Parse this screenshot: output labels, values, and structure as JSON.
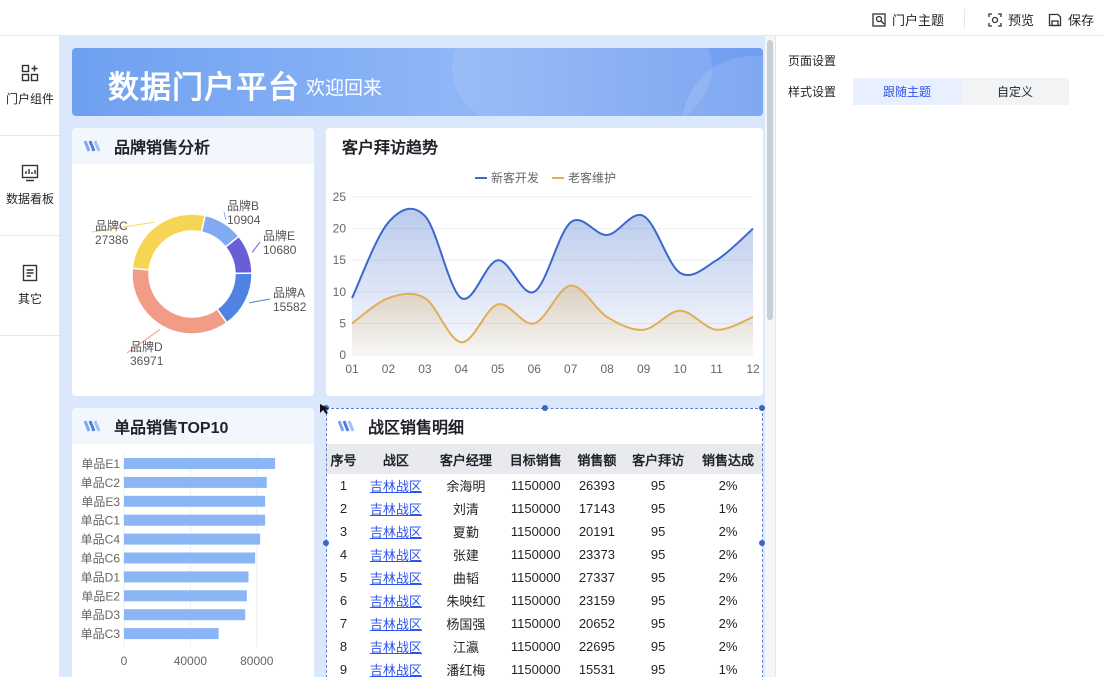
{
  "topbar": {
    "theme_label": "门户主题",
    "preview_label": "预览",
    "save_label": "保存"
  },
  "leftnav": {
    "items": [
      {
        "label": "门户组件",
        "icon": "components-icon"
      },
      {
        "label": "数据看板",
        "icon": "dashboard-icon"
      },
      {
        "label": "其它",
        "icon": "document-icon"
      }
    ]
  },
  "banner": {
    "title": "数据门户平台",
    "subtitle": "欢迎回来"
  },
  "cards": {
    "brand_title": "品牌销售分析",
    "visit_title": "客户拜访趋势",
    "top10_title": "单品销售TOP10",
    "region_title": "战区销售明细"
  },
  "right_panel": {
    "page_settings": "页面设置",
    "style_settings": "样式设置",
    "options": [
      "跟随主题",
      "自定义"
    ],
    "selected": "跟随主题"
  },
  "colors": {
    "accent": "#2f54eb",
    "line_new": "#3b68cc",
    "line_old": "#e0ae56"
  },
  "chart_data": [
    {
      "type": "pie",
      "donut": true,
      "title": "品牌销售分析",
      "slices": [
        {
          "name": "品牌B",
          "value": 10904,
          "color": "#82aaf0"
        },
        {
          "name": "品牌E",
          "value": 10680,
          "color": "#6a5ed6"
        },
        {
          "name": "品牌A",
          "value": 15582,
          "color": "#4f82e3"
        },
        {
          "name": "品牌D",
          "value": 36971,
          "color": "#f29b86"
        },
        {
          "name": "品牌C",
          "value": 27386,
          "color": "#f6d555"
        }
      ]
    },
    {
      "type": "line",
      "title": "客户拜访趋势",
      "x": [
        "01",
        "02",
        "03",
        "04",
        "05",
        "06",
        "07",
        "08",
        "09",
        "10",
        "11",
        "12"
      ],
      "ylim": [
        0,
        25
      ],
      "yticks": [
        0,
        5,
        10,
        15,
        20,
        25
      ],
      "legend": "top-center",
      "series": [
        {
          "name": "新客开发",
          "values": [
            9,
            21,
            22,
            9,
            15,
            10,
            21,
            19,
            22,
            13,
            15,
            20
          ]
        },
        {
          "name": "老客维护",
          "values": [
            5,
            9,
            9,
            2,
            8,
            5,
            11,
            6,
            4,
            7,
            4,
            6
          ]
        }
      ]
    },
    {
      "type": "bar",
      "orientation": "horizontal",
      "title": "单品销售TOP10",
      "categories": [
        "单品E1",
        "单品C2",
        "单品E3",
        "单品C1",
        "单品C4",
        "单品C6",
        "单品D1",
        "单品E2",
        "单品D3",
        "单品C3"
      ],
      "values": [
        91000,
        86000,
        85000,
        85000,
        82000,
        79000,
        75000,
        74000,
        73000,
        57000
      ],
      "xlim": [
        0,
        100000
      ],
      "xticks": [
        0,
        40000,
        80000
      ]
    }
  ],
  "table": {
    "columns": [
      "序号",
      "战区",
      "客户经理",
      "目标销售",
      "销售额",
      "客户拜访",
      "销售达成"
    ],
    "rows": [
      [
        "1",
        "吉林战区",
        "余海明",
        "1150000",
        "26393",
        "95",
        "2%"
      ],
      [
        "2",
        "吉林战区",
        "刘清",
        "1150000",
        "17143",
        "95",
        "1%"
      ],
      [
        "3",
        "吉林战区",
        "夏勤",
        "1150000",
        "20191",
        "95",
        "2%"
      ],
      [
        "4",
        "吉林战区",
        "张建",
        "1150000",
        "23373",
        "95",
        "2%"
      ],
      [
        "5",
        "吉林战区",
        "曲韬",
        "1150000",
        "27337",
        "95",
        "2%"
      ],
      [
        "6",
        "吉林战区",
        "朱映红",
        "1150000",
        "23159",
        "95",
        "2%"
      ],
      [
        "7",
        "吉林战区",
        "杨国强",
        "1150000",
        "20652",
        "95",
        "2%"
      ],
      [
        "8",
        "吉林战区",
        "江瀛",
        "1150000",
        "22695",
        "95",
        "2%"
      ],
      [
        "9",
        "吉林战区",
        "潘红梅",
        "1150000",
        "15531",
        "95",
        "1%"
      ]
    ]
  }
}
